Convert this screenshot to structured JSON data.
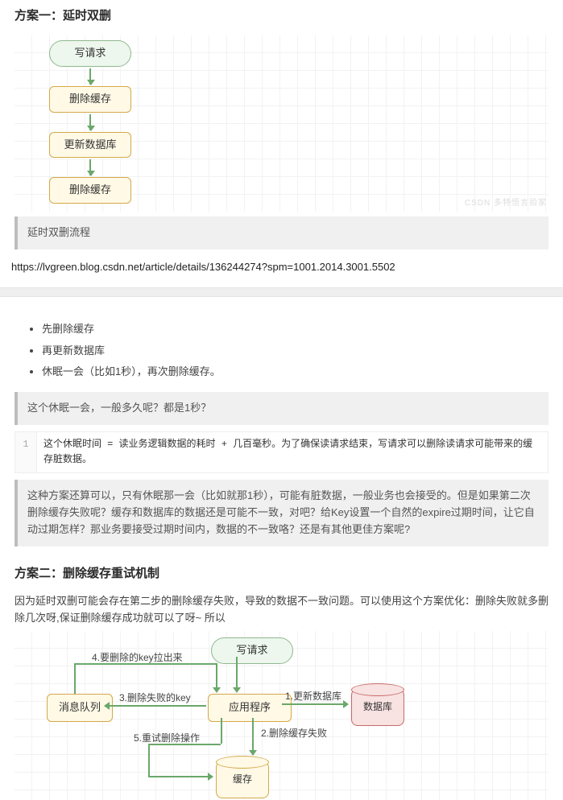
{
  "section1": {
    "title": "方案一：延时双删",
    "flow": {
      "start": "写请求",
      "steps": [
        "删除缓存",
        "更新数据库",
        "删除缓存"
      ]
    },
    "caption": "延时双删流程",
    "watermark": "CSDN 多特悟言验家",
    "url": "https://lvgreen.blog.csdn.net/article/details/136244274?spm=1001.2014.3001.5502",
    "bullets": [
      "先删除缓存",
      "再更新数据库",
      "休眠一会（比如1秒），再次删除缓存。"
    ],
    "note1": "这个休眠一会，一般多久呢？都是1秒？",
    "code": "这个休眠时间 =  读业务逻辑数据的耗时  +  几百毫秒。为了确保读请求结束，写请求可以删除读请求可能带来的缓存脏数据。",
    "note2": "这种方案还算可以，只有休眠那一会（比如就那1秒），可能有脏数据，一般业务也会接受的。但是如果第二次删除缓存失败呢？缓存和数据库的数据还是可能不一致，对吧？给Key设置一个自然的expire过期时间，让它自动过期怎样？那业务要接受过期时间内，数据的不一致咯？还是有其他更佳方案呢?"
  },
  "section2": {
    "title": "方案二：删除缓存重试机制",
    "intro": "因为延时双删可能会存在第二步的删除缓存失败，导致的数据不一致问题。可以使用这个方案优化：删除失败就多删除几次呀,保证删除缓存成功就可以了呀~ 所以",
    "diagram": {
      "start": "写请求",
      "mq": "消息队列",
      "app": "应用程序",
      "db": "数据库",
      "cache": "缓存",
      "labels": {
        "l1": "1.更新数据库",
        "l2": "2.删除缓存失败",
        "l3": "3.删除失败的key",
        "l4": "4.要删除的key拉出来",
        "l5": "5.重试删除操作"
      }
    }
  }
}
